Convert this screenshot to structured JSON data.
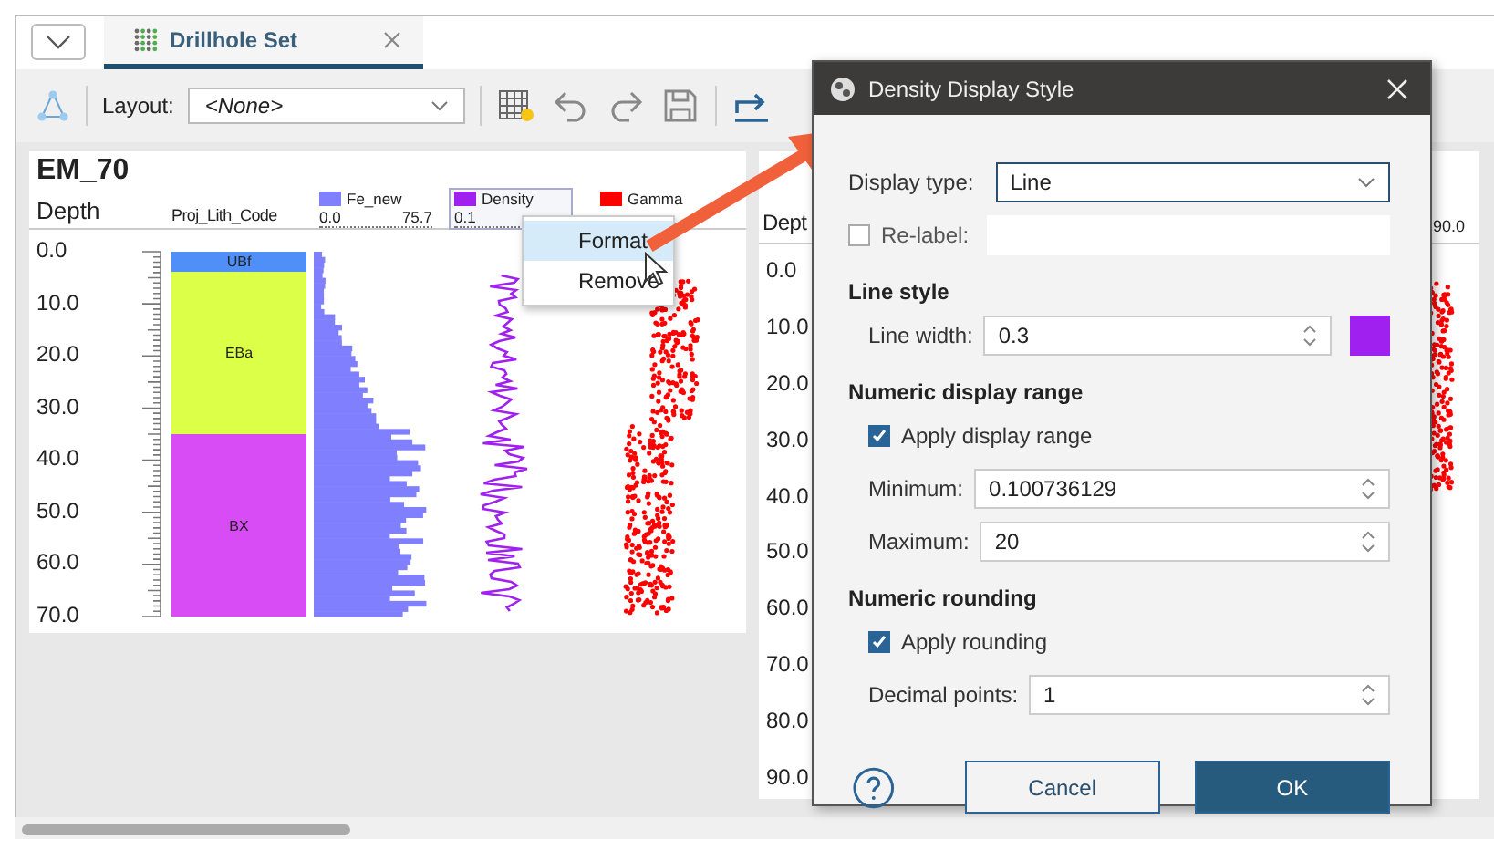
{
  "tabs": [
    {
      "label": "Drillhole Set",
      "selected": true
    }
  ],
  "toolbar": {
    "layout_label": "Layout:",
    "layout_value": "<None>"
  },
  "panels": [
    {
      "title": "EM_70",
      "depth_label": "Depth",
      "depth_ticks": [
        "0.0",
        "10.0",
        "20.0",
        "30.0",
        "40.0",
        "50.0",
        "60.0",
        "70.0"
      ],
      "columns": [
        {
          "kind": "category",
          "label": "Proj_Lith_Code",
          "intervals": [
            {
              "label": "UBf",
              "color": "#4f8ff7"
            },
            {
              "label": "EBa",
              "color": "#dcff48"
            },
            {
              "label": "BX",
              "color": "#d84cf5"
            }
          ]
        },
        {
          "kind": "bars",
          "label": "Fe_new",
          "color": "#8080ff",
          "min": "0.0",
          "max": "75.7",
          "selected": false
        },
        {
          "kind": "line",
          "label": "Density",
          "color": "#a020f0",
          "min": "0.1",
          "selected": true
        },
        {
          "kind": "points",
          "label": "Gamma",
          "color": "#ff0000",
          "selected": false
        }
      ]
    },
    {
      "depth_label": "Dept",
      "depth_ticks": [
        "0.0",
        "10.0",
        "20.0",
        "30.0",
        "40.0",
        "50.0",
        "60.0",
        "70.0",
        "80.0",
        "90.0"
      ],
      "scale_max": "90.0",
      "color": "#ff0000"
    }
  ],
  "context_menu": [
    {
      "label": "Format",
      "selected": true
    },
    {
      "label": "Remove",
      "selected": false
    }
  ],
  "dialog": {
    "title": "Density Display Style",
    "rows": [
      {
        "kind": "select",
        "label": "Display type:",
        "value": "Line"
      },
      {
        "kind": "check_field",
        "label": "Re-label:",
        "checked": false
      },
      {
        "kind": "heading",
        "label": "Line style"
      },
      {
        "kind": "spin",
        "label": "Line width:",
        "value": "0.3",
        "color": "#a020f0"
      },
      {
        "kind": "heading",
        "label": "Numeric display range"
      },
      {
        "kind": "checkbox",
        "label": "Apply display range",
        "checked": true
      },
      {
        "kind": "spin",
        "label": "Minimum:",
        "value": "0.100736129"
      },
      {
        "kind": "spin",
        "label": "Maximum:",
        "value": "20"
      },
      {
        "kind": "heading",
        "label": "Numeric rounding"
      },
      {
        "kind": "checkbox",
        "label": "Apply rounding",
        "checked": true
      },
      {
        "kind": "spin",
        "label": "Decimal points:",
        "value": "1"
      }
    ],
    "buttons": [
      {
        "label": "Cancel",
        "kind": "secondary"
      },
      {
        "label": "OK",
        "kind": "primary"
      }
    ]
  }
}
